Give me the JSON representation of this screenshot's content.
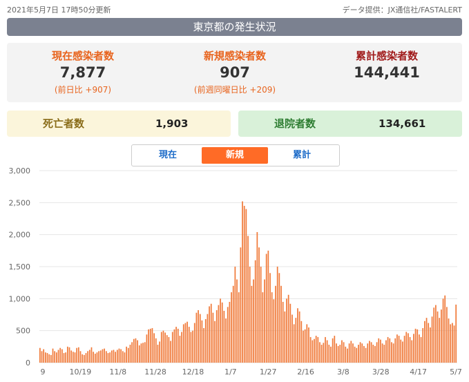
{
  "header": {
    "updated": "2021年5月7日 17時50分更新",
    "source": "データ提供：JX通信社/FASTALERT",
    "title": "東京都の発生状況"
  },
  "stats": {
    "current": {
      "label": "現在感染者数",
      "value": "7,877",
      "sub": "(前日比 +907)"
    },
    "new": {
      "label": "新規感染者数",
      "value": "907",
      "sub": "(前週同曜日比 +209)"
    },
    "cumulative": {
      "label": "累計感染者数",
      "value": "144,441"
    }
  },
  "deaths": {
    "label": "死亡者数",
    "value": "1,903"
  },
  "discharged": {
    "label": "退院者数",
    "value": "134,661"
  },
  "tabs": [
    "現在",
    "新規",
    "累計"
  ],
  "active_tab": "新規",
  "colors": {
    "bar": "#f07a3a",
    "active_tab": "#ff6b26",
    "tab_text": "#1f6dc9"
  },
  "chart_data": {
    "type": "bar",
    "ylim": [
      0,
      3000
    ],
    "yticks": [
      "0",
      "500",
      "1,000",
      "1,500",
      "2,000",
      "2,500",
      "3,000"
    ],
    "xtick_labels": [
      "9",
      "10/19",
      "11/8",
      "11/28",
      "12/18",
      "1/7",
      "1/27",
      "2/16",
      "3/8",
      "3/28",
      "4/17",
      "5/7"
    ],
    "grid": true,
    "series": [
      {
        "values": [
          230,
          180,
          210,
          160,
          150,
          130,
          120,
          220,
          180,
          160,
          200,
          230,
          210,
          150,
          160,
          250,
          240,
          190,
          170,
          160,
          230,
          240,
          180,
          130,
          120,
          150,
          180,
          200,
          240,
          170,
          140,
          160,
          180,
          190,
          210,
          220,
          180,
          150,
          160,
          190,
          200,
          170,
          200,
          220,
          210,
          180,
          160,
          250,
          230,
          280,
          320,
          370,
          380,
          350,
          270,
          300,
          310,
          320,
          440,
          520,
          530,
          540,
          460,
          380,
          280,
          330,
          480,
          500,
          470,
          430,
          400,
          340,
          480,
          520,
          560,
          530,
          420,
          480,
          600,
          620,
          640,
          560,
          480,
          500,
          620,
          780,
          820,
          760,
          660,
          540,
          680,
          760,
          880,
          920,
          780,
          650,
          820,
          900,
          1000,
          940,
          810,
          690,
          870,
          950,
          1100,
          1200,
          1500,
          1300,
          1100,
          1800,
          2520,
          2450,
          2400,
          1980,
          1500,
          1200,
          1300,
          1600,
          2040,
          1800,
          1500,
          1100,
          1300,
          1700,
          1750,
          1400,
          1100,
          990,
          1200,
          1500,
          1400,
          1200,
          950,
          800,
          1000,
          1060,
          920,
          750,
          600,
          700,
          850,
          800,
          650,
          500,
          520,
          600,
          550,
          400,
          350,
          370,
          420,
          400,
          320,
          280,
          310,
          400,
          350,
          280,
          250,
          380,
          420,
          300,
          260,
          280,
          350,
          320,
          250,
          220,
          300,
          340,
          300,
          250,
          230,
          280,
          320,
          300,
          260,
          230,
          300,
          340,
          320,
          280,
          260,
          320,
          380,
          360,
          300,
          280,
          350,
          400,
          380,
          320,
          300,
          380,
          440,
          420,
          360,
          330,
          420,
          480,
          460,
          400,
          350,
          450,
          530,
          520,
          440,
          400,
          540,
          650,
          700,
          620,
          550,
          720,
          860,
          900,
          800,
          700,
          830,
          1000,
          1050,
          870,
          690,
          600,
          620,
          580,
          907
        ]
      }
    ]
  }
}
